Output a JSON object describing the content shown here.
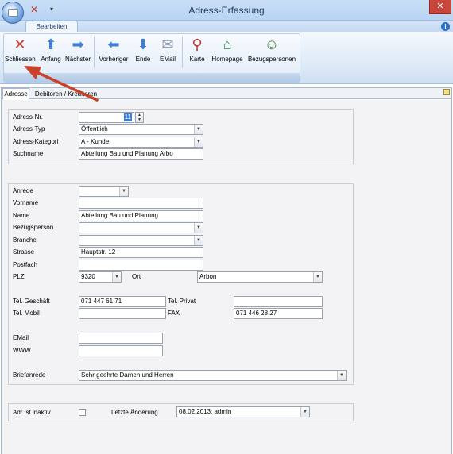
{
  "window": {
    "title": "Adress-Erfassung",
    "close_glyph": "✕",
    "quickaccess_close_glyph": "✕",
    "quickaccess_dropdown_glyph": "▾",
    "help_glyph": "i"
  },
  "ribbon": {
    "tab": "Bearbeiten",
    "buttons": [
      {
        "label": "Schliessen",
        "icon": "close-x-icon",
        "glyph": "✕",
        "color": "#d23c2f"
      },
      {
        "label": "Anfang",
        "icon": "arrow-up-icon",
        "glyph": "⬆",
        "color": "#3f7fd3"
      },
      {
        "label": "Nächster",
        "icon": "arrow-right-icon",
        "glyph": "➡",
        "color": "#3f7fd3"
      },
      {
        "label": "Vorheriger",
        "icon": "arrow-left-icon",
        "glyph": "⬅",
        "color": "#3f7fd3"
      },
      {
        "label": "Ende",
        "icon": "arrow-down-icon",
        "glyph": "⬇",
        "color": "#3f7fd3"
      },
      {
        "label": "EMail",
        "icon": "envelope-icon",
        "glyph": "✉",
        "color": "#8a9aaa"
      },
      {
        "label": "Karte",
        "icon": "map-pin-icon",
        "glyph": "⚲",
        "color": "#c0392b"
      },
      {
        "label": "Homepage",
        "icon": "home-icon",
        "glyph": "⌂",
        "color": "#2a8f4a"
      },
      {
        "label": "Bezugspersonen",
        "icon": "people-icon",
        "glyph": "☺",
        "color": "#4d7a3a"
      }
    ]
  },
  "tabs": {
    "adresse": "Adresse",
    "debitoren": "Debitoren / Kreditoren"
  },
  "form": {
    "adress_nr": {
      "label": "Adress-Nr.",
      "value": "11"
    },
    "adress_typ": {
      "label": "Adress-Typ",
      "value": "Öffentlich"
    },
    "adress_kategori": {
      "label": "Adress-Kategori",
      "value": "A - Kunde"
    },
    "suchname": {
      "label": "Suchname",
      "value": "Abteilung Bau und Planung Arbo"
    },
    "anrede": {
      "label": "Anrede",
      "value": ""
    },
    "vorname": {
      "label": "Vorname",
      "value": ""
    },
    "name": {
      "label": "Name",
      "value": "Abteilung Bau und Planung"
    },
    "bezugsperson": {
      "label": "Bezugsperson",
      "value": ""
    },
    "branche": {
      "label": "Branche",
      "value": ""
    },
    "strasse": {
      "label": "Strasse",
      "value": "Hauptstr. 12"
    },
    "postfach": {
      "label": "Postfach",
      "value": ""
    },
    "plz": {
      "label": "PLZ",
      "value": "9320"
    },
    "ort": {
      "label": "Ort",
      "value": "Arbon"
    },
    "tel_geschaeft": {
      "label": "Tel. Geschäft",
      "value": "071 447 61 71"
    },
    "tel_privat": {
      "label": "Tel. Privat",
      "value": ""
    },
    "tel_mobil": {
      "label": "Tel. Mobil",
      "value": ""
    },
    "fax": {
      "label": "FAX",
      "value": "071 446 28 27"
    },
    "email": {
      "label": "EMail",
      "value": ""
    },
    "www": {
      "label": "WWW",
      "value": ""
    },
    "briefanrede": {
      "label": "Briefanrede",
      "value": "Sehr geehrte Damen und Herren"
    },
    "inaktiv": {
      "label": "Adr ist inaktiv",
      "checked": false
    },
    "letzte_aenderung": {
      "label": "Letzte Änderung",
      "value": "08.02.2013: admin"
    }
  },
  "colors": {
    "annotation_arrow": "#c8422a"
  }
}
